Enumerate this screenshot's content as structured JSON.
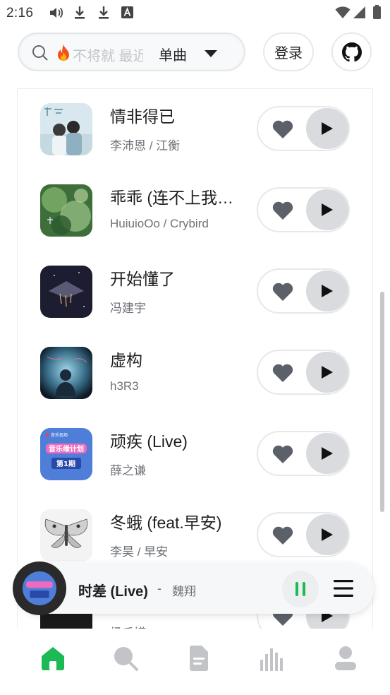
{
  "status_bar": {
    "time": "2:16",
    "icons": [
      "volume-icon",
      "download-icon",
      "download-icon",
      "translate-icon",
      "wifi-icon",
      "signal-icon",
      "battery-icon"
    ]
  },
  "search": {
    "placeholder": "不将就 最近",
    "type_label": "单曲"
  },
  "header": {
    "login_label": "登录",
    "github_icon": "github-icon"
  },
  "songs": [
    {
      "title": "情非得已",
      "artist": "李沛恩 / 江衡"
    },
    {
      "title": "乖乖 (连不上我…",
      "artist": "HuiuioOo / Crybird"
    },
    {
      "title": "开始懂了",
      "artist": "冯建宇"
    },
    {
      "title": "虚构",
      "artist": "h3R3"
    },
    {
      "title": "顽疾 (Live)",
      "artist": "薛之谦"
    },
    {
      "title": "冬蛾 (feat.早安)",
      "artist": "李昊 / 早安"
    },
    {
      "title": "",
      "artist": "杨千嬅"
    }
  ],
  "cover_text": {
    "song5_top": "音乐现场",
    "song5_mid": "音乐缘计划",
    "song5_bottom": "第1期"
  },
  "now_playing": {
    "title": "时差 (Live)",
    "separator": "-",
    "artist": "魏翔",
    "state": "playing"
  },
  "bottom_nav": {
    "items": [
      "home",
      "search",
      "playlist",
      "charts",
      "profile"
    ],
    "active": "home"
  },
  "colors": {
    "accent": "#1db954",
    "nav_inactive": "#c2c4c7",
    "play_bg": "#d9dbde",
    "heart": "#5c6169"
  }
}
